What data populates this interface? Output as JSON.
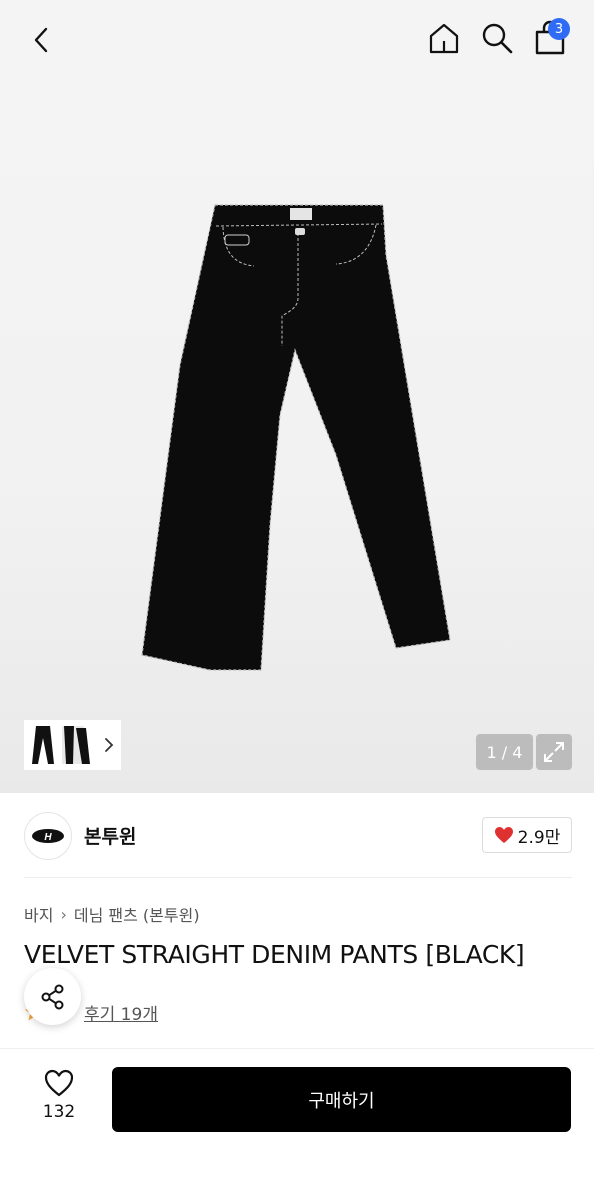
{
  "header": {
    "cart_count": "3",
    "icons": [
      "back-icon",
      "home-icon",
      "search-icon",
      "shopping-bag-icon"
    ]
  },
  "gallery": {
    "page_indicator": "1 / 4",
    "icons": [
      "chevron-right-icon",
      "expand-icon"
    ]
  },
  "brand": {
    "name": "본투윈",
    "like_count": "2.9만",
    "like_color": "#e03131"
  },
  "breadcrumb": {
    "items": [
      "바지",
      "데님 팬츠 (본투윈)"
    ]
  },
  "product": {
    "title": "VELVET STRAIGHT DENIM PANTS [BLACK]",
    "review_text": "후기 19개"
  },
  "footer": {
    "wish_count": "132",
    "buy_label": "구매하기"
  },
  "colors": {
    "badge": "#2f6cf6",
    "buy_button": "#000000"
  }
}
